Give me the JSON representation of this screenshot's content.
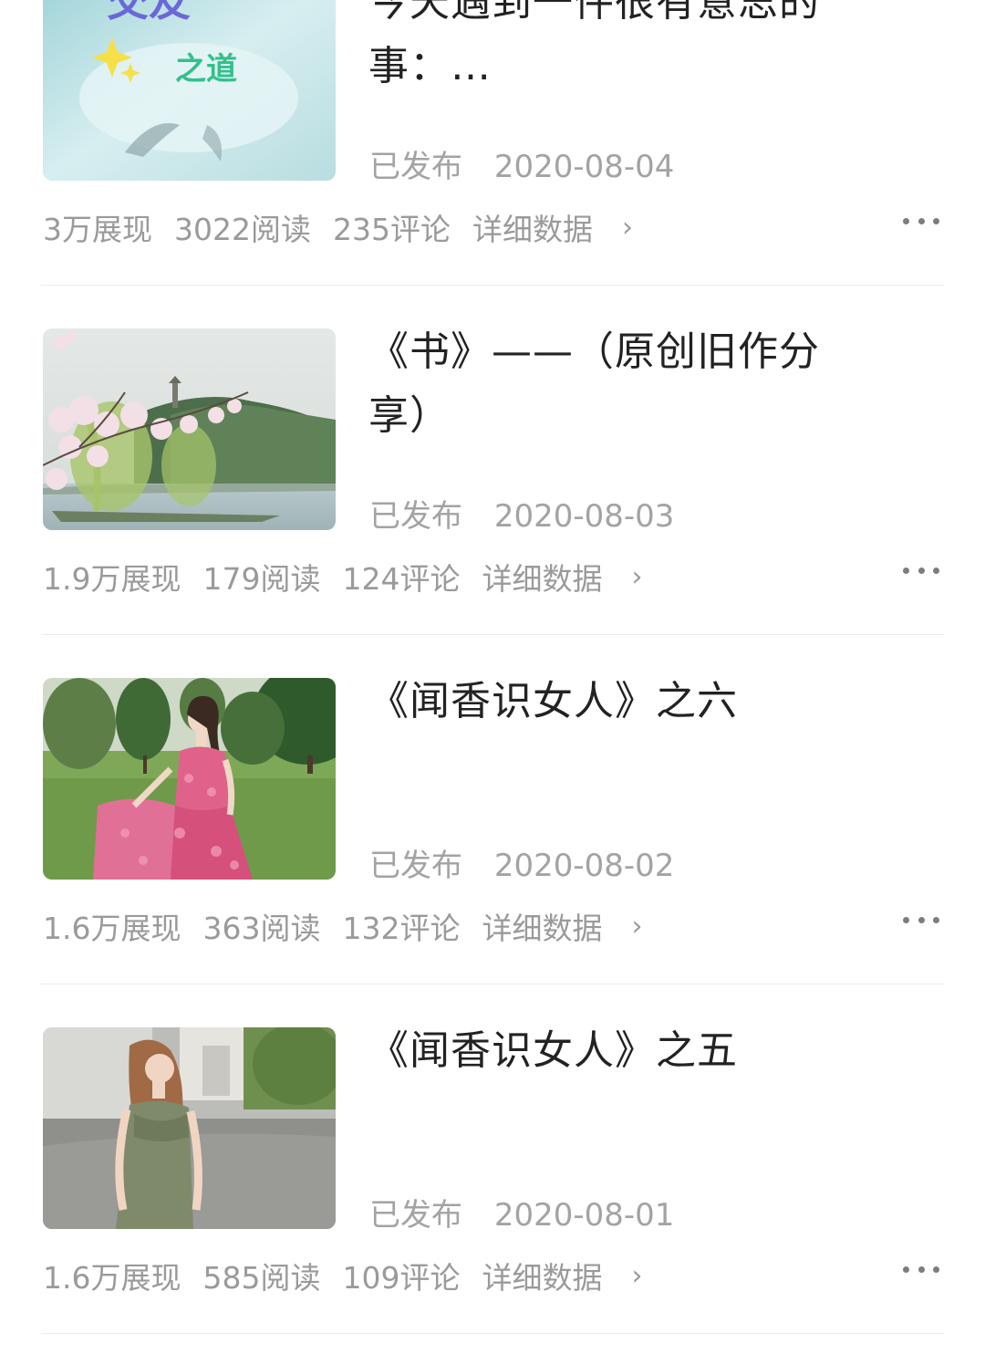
{
  "articles": [
    {
      "title": "今天遇到一件很有意思的事：…",
      "status": "已发布",
      "date": "2020-08-04",
      "impressions": "3万展现",
      "reads": "3022阅读",
      "comments": "235评论",
      "detail_label": "详细数据",
      "thumb_text": [
        "交友",
        "之道"
      ]
    },
    {
      "title": "《书》——（原创旧作分享）",
      "status": "已发布",
      "date": "2020-08-03",
      "impressions": "1.9万展现",
      "reads": "179阅读",
      "comments": "124评论",
      "detail_label": "详细数据"
    },
    {
      "title": "《闻香识女人》之六",
      "status": "已发布",
      "date": "2020-08-02",
      "impressions": "1.6万展现",
      "reads": "363阅读",
      "comments": "132评论",
      "detail_label": "详细数据"
    },
    {
      "title": "《闻香识女人》之五",
      "status": "已发布",
      "date": "2020-08-01",
      "impressions": "1.6万展现",
      "reads": "585阅读",
      "comments": "109评论",
      "detail_label": "详细数据"
    }
  ],
  "icons": {
    "more": "more-dots-icon",
    "chevron": "chevron-right-icon"
  },
  "colors": {
    "title": "#222222",
    "meta": "#a3a3a3",
    "divider": "#ececec"
  }
}
